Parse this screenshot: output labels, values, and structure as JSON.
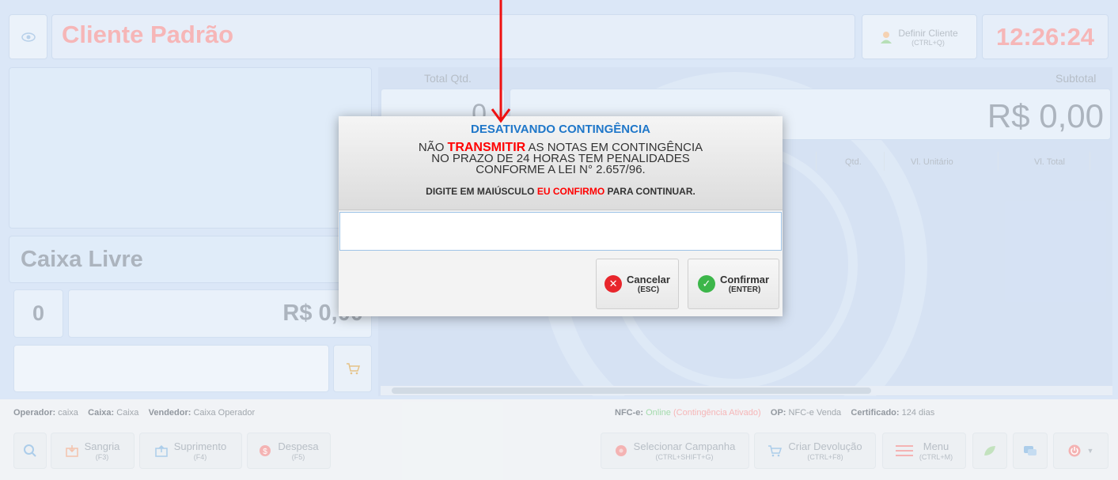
{
  "header": {
    "customer_name": "Cliente Padrão",
    "define_customer_label": "Definir Cliente",
    "define_customer_shortcut": "(CTRL+Q)",
    "clock": "12:26:24"
  },
  "left": {
    "register_status": "Caixa Livre",
    "item_count": "0",
    "amount": "R$ 0,00"
  },
  "main": {
    "total_qty_label": "Total Qtd.",
    "total_qty_value": "0",
    "subtotal_label": "Subtotal",
    "subtotal_value": "R$ 0,00",
    "columns": [
      "Qtd.",
      "Vl. Unitário",
      "Vl. Total"
    ]
  },
  "status_bar": {
    "operator_label": "Operador:",
    "operator_value": "caixa",
    "register_label": "Caixa:",
    "register_value": "Caixa",
    "seller_label": "Vendedor:",
    "seller_value": "Caixa Operador",
    "nfce_label": "NFC-e:",
    "nfce_status": "Online",
    "contingency_status": "(Contingência Ativado)",
    "op_label": "OP:",
    "op_value": "NFC-e Venda",
    "cert_label": "Certificado:",
    "cert_value": "124 dias"
  },
  "toolbar": {
    "sangria": {
      "label": "Sangria",
      "shortcut": "(F3)"
    },
    "suprimento": {
      "label": "Suprimento",
      "shortcut": "(F4)"
    },
    "despesa": {
      "label": "Despesa",
      "shortcut": "(F5)"
    },
    "campanha": {
      "label": "Selecionar Campanha",
      "shortcut": "(CTRL+SHIFT+G)"
    },
    "devolucao": {
      "label": "Criar Devolução",
      "shortcut": "(CTRL+F8)"
    },
    "menu": {
      "label": "Menu",
      "shortcut": "(CTRL+M)"
    }
  },
  "dialog": {
    "title": "DESATIVANDO CONTINGÊNCIA",
    "line1_pre": "NÃO ",
    "line1_highlight": "TRANSMITIR",
    "line1_post": " AS NOTAS EM CONTINGÊNCIA",
    "line2": "NO PRAZO DE 24 HORAS TEM PENALIDADES",
    "line3": "CONFORME A LEI N° 2.657/96.",
    "confirm_pre": "DIGITE EM MAIÚSCULO ",
    "confirm_highlight": "EU CONFIRMO",
    "confirm_post": " PARA CONTINUAR.",
    "input_value": "",
    "cancel_label": "Cancelar",
    "cancel_shortcut": "(ESC)",
    "confirm_label": "Confirmar",
    "confirm_shortcut": "(ENTER)"
  },
  "colors": {
    "accent_blue": "#1f77c9",
    "warning_red": "#ff0000",
    "customer_pink": "#f4a6a8",
    "success_green": "#3cb64a"
  }
}
